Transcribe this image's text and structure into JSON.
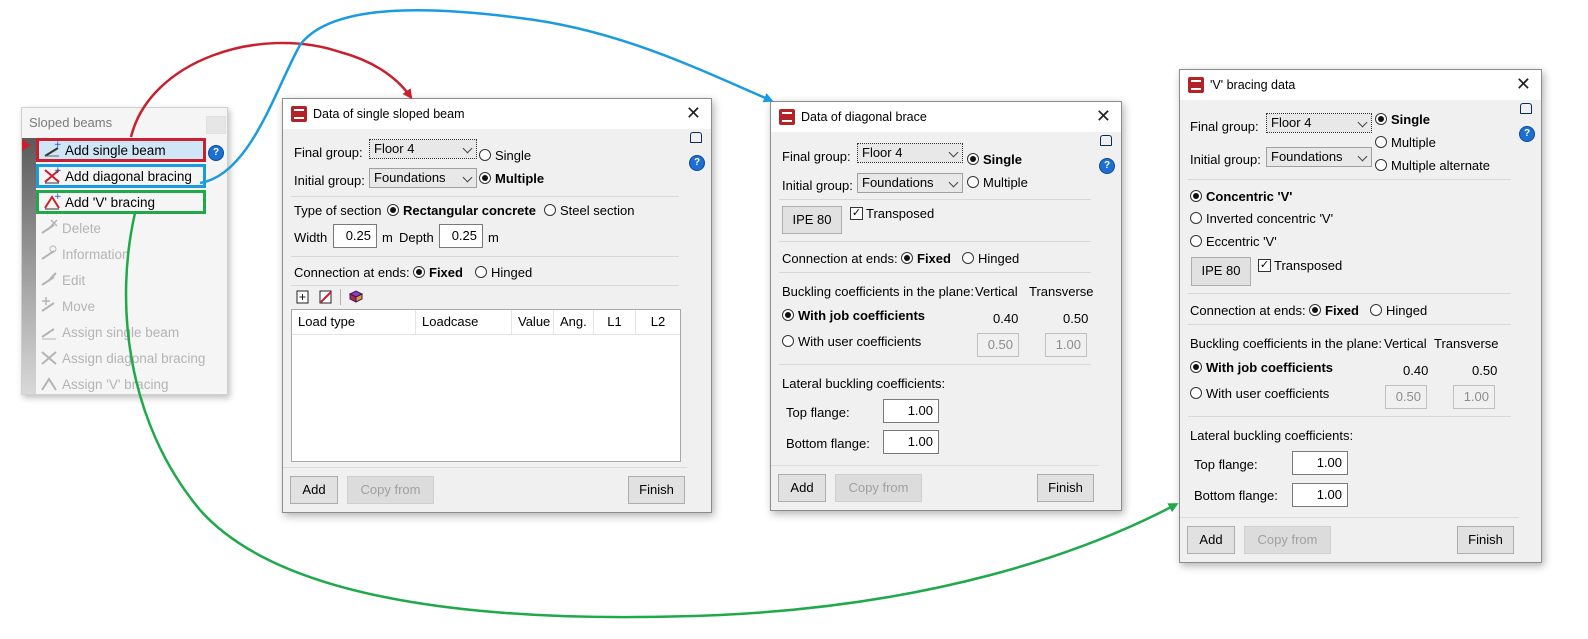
{
  "menu": {
    "title": "Sloped beams",
    "items": [
      {
        "label": "Add single beam",
        "enabled": true
      },
      {
        "label": "Add diagonal bracing",
        "enabled": true
      },
      {
        "label": "Add 'V' bracing",
        "enabled": true
      },
      {
        "label": "Delete",
        "enabled": false
      },
      {
        "label": "Information",
        "enabled": false
      },
      {
        "label": "Edit",
        "enabled": false
      },
      {
        "label": "Move",
        "enabled": false
      },
      {
        "label": "Assign single beam",
        "enabled": false
      },
      {
        "label": "Assign diagonal bracing",
        "enabled": false
      },
      {
        "label": "Assign 'V' bracing",
        "enabled": false
      }
    ],
    "help_glyph": "?"
  },
  "colors": {
    "red": "#c8202e",
    "blue": "#1a9be0",
    "green": "#1fa94a"
  },
  "dialog1": {
    "title": "Data of single sloped beam",
    "final_group_label": "Final group:",
    "final_group_value": "Floor 4",
    "initial_group_label": "Initial group:",
    "initial_group_value": "Foundations",
    "single_label": "Single",
    "multiple_label": "Multiple",
    "section_type_label": "Type of section",
    "rect_concrete_label": "Rectangular concrete",
    "steel_section_label": "Steel section",
    "width_label": "Width",
    "width_value": "0.25",
    "width_unit": "m",
    "depth_label": "Depth",
    "depth_value": "0.25",
    "depth_unit": "m",
    "connection_label": "Connection at ends:",
    "fixed_label": "Fixed",
    "hinged_label": "Hinged",
    "columns": [
      "Load type",
      "Loadcase",
      "Value",
      "Ang.",
      "L1",
      "L2"
    ],
    "add_button": "Add",
    "copy_button": "Copy from",
    "finish_button": "Finish"
  },
  "dialog2": {
    "title": "Data of diagonal brace",
    "final_group_label": "Final group:",
    "final_group_value": "Floor 4",
    "initial_group_label": "Initial group:",
    "initial_group_value": "Foundations",
    "single_label": "Single",
    "multiple_label": "Multiple",
    "section_button": "IPE 80",
    "transposed_label": "Transposed",
    "connection_label": "Connection at ends:",
    "fixed_label": "Fixed",
    "hinged_label": "Hinged",
    "buckling_label": "Buckling coefficients in the plane:",
    "vertical_label": "Vertical",
    "transverse_label": "Transverse",
    "job_coeff_label": "With job coefficients",
    "job_vertical": "0.40",
    "job_transverse": "0.50",
    "user_coeff_label": "With user coefficients",
    "user_vertical": "0.50",
    "user_transverse": "1.00",
    "lateral_label": "Lateral buckling coefficients:",
    "top_flange_label": "Top flange:",
    "top_flange_value": "1.00",
    "bottom_flange_label": "Bottom flange:",
    "bottom_flange_value": "1.00",
    "add_button": "Add",
    "copy_button": "Copy from",
    "finish_button": "Finish"
  },
  "dialog3": {
    "title": "'V' bracing data",
    "final_group_label": "Final group:",
    "final_group_value": "Floor 4",
    "initial_group_label": "Initial group:",
    "initial_group_value": "Foundations",
    "single_label": "Single",
    "multiple_label": "Multiple",
    "multiple_alt_label": "Multiple alternate",
    "concentric_label": "Concentric 'V'",
    "inverted_label": "Inverted concentric 'V'",
    "eccentric_label": "Eccentric 'V'",
    "section_button": "IPE 80",
    "transposed_label": "Transposed",
    "connection_label": "Connection at ends:",
    "fixed_label": "Fixed",
    "hinged_label": "Hinged",
    "buckling_label": "Buckling coefficients in the plane:",
    "vertical_label": "Vertical",
    "transverse_label": "Transverse",
    "job_coeff_label": "With job coefficients",
    "job_vertical": "0.40",
    "job_transverse": "0.50",
    "user_coeff_label": "With user coefficients",
    "user_vertical": "0.50",
    "user_transverse": "1.00",
    "lateral_label": "Lateral buckling coefficients:",
    "top_flange_label": "Top flange:",
    "top_flange_value": "1.00",
    "bottom_flange_label": "Bottom flange:",
    "bottom_flange_value": "1.00",
    "add_button": "Add",
    "copy_button": "Copy from",
    "finish_button": "Finish"
  }
}
